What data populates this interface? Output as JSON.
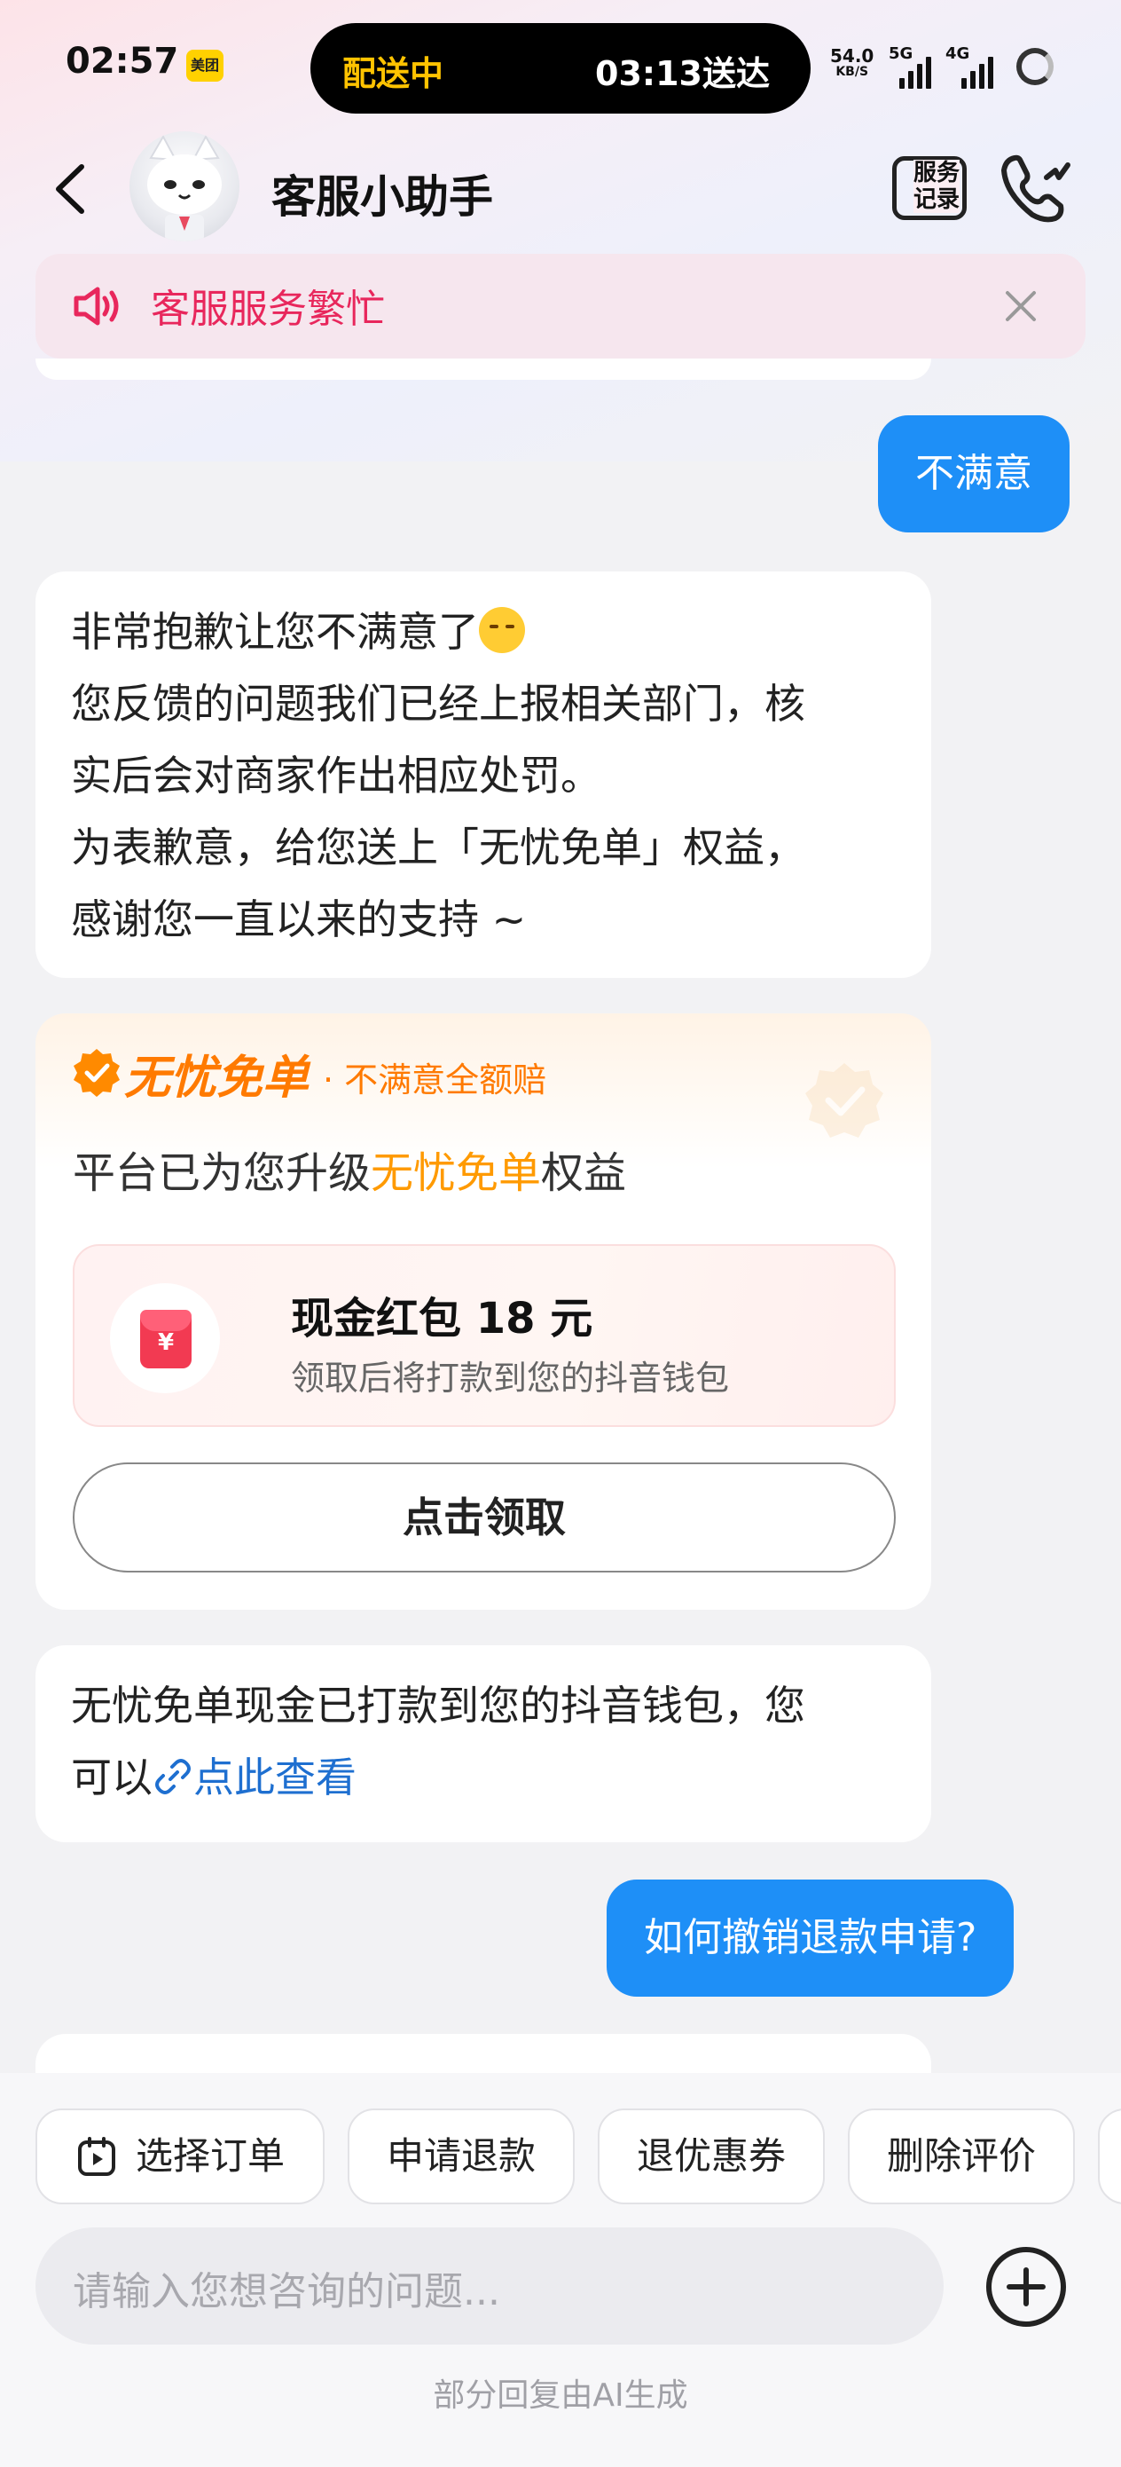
{
  "status_bar": {
    "time": "02:57",
    "app_badge": "美团",
    "delivery_status": "配送中",
    "delivery_eta": "03:13送达",
    "net_speed": "54.0",
    "net_unit": "KB/S",
    "tag_5g": "5G",
    "tag_4g": "4G"
  },
  "nav": {
    "title": "客服小助手",
    "service_record_label": "服务\n记录",
    "back_icon": "chevron-left-icon",
    "call_icon": "phone-icon"
  },
  "notice": {
    "text": "客服服务繁忙"
  },
  "messages": {
    "user_1": "不满意",
    "agent_1": {
      "line1": "非常抱歉让您不满意了",
      "line2": "您反馈的问题我们已经上报相关部门，核",
      "line3": "实后会对商家作出相应处罚。",
      "line4": "为表歉意，给您送上「无忧免单」权益，",
      "line5": "感谢您一直以来的支持 ~"
    },
    "benefit": {
      "title": "无忧免单",
      "subtitle": "· 不满意全额赔",
      "line_prefix": "平台已为您升级",
      "line_highlight": "无忧免单",
      "line_suffix": "权益",
      "redpack_symbol": "¥",
      "redpack_title": "现金红包 18 元",
      "redpack_desc": "领取后将打款到您的抖音钱包",
      "claim_button": "点击领取"
    },
    "agent_2": {
      "line1": "无忧免单现金已打款到您的抖音钱包，您",
      "line2_prefix": "可以",
      "link": "点此查看"
    },
    "user_2": "如何撤销退款申请?"
  },
  "quick_actions": [
    "选择订单",
    "申请退款",
    "退优惠券",
    "删除评价"
  ],
  "input": {
    "placeholder": "请输入您想咨询的问题..."
  },
  "footer_note": "部分回复由AI生成",
  "colors": {
    "accent_blue": "#1e8ff7",
    "notice_red": "#e8275c",
    "benefit_orange": "#ff7a00",
    "link_blue": "#1e6fd0"
  }
}
